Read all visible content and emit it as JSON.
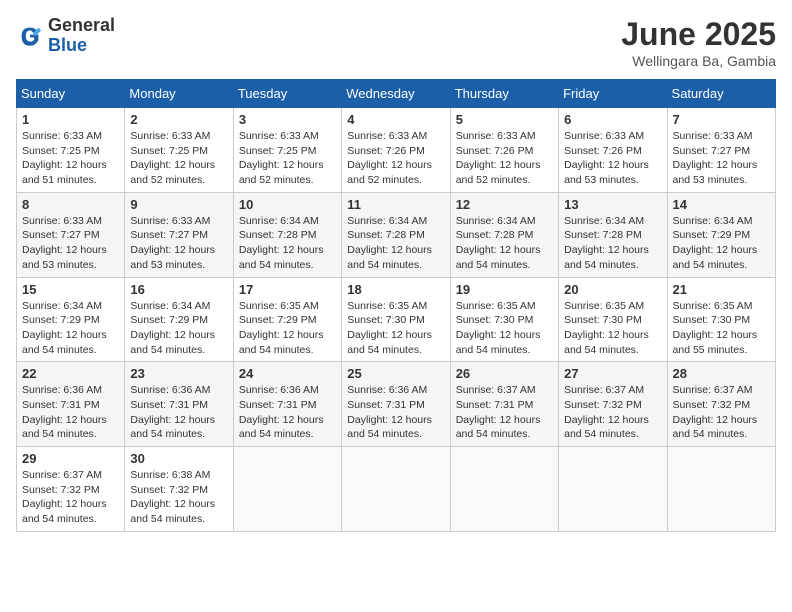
{
  "logo": {
    "general": "General",
    "blue": "Blue"
  },
  "title": {
    "month": "June 2025",
    "location": "Wellingara Ba, Gambia"
  },
  "headers": [
    "Sunday",
    "Monday",
    "Tuesday",
    "Wednesday",
    "Thursday",
    "Friday",
    "Saturday"
  ],
  "weeks": [
    [
      {
        "day": "1",
        "sunrise": "6:33 AM",
        "sunset": "7:25 PM",
        "daylight": "12 hours and 51 minutes."
      },
      {
        "day": "2",
        "sunrise": "6:33 AM",
        "sunset": "7:25 PM",
        "daylight": "12 hours and 52 minutes."
      },
      {
        "day": "3",
        "sunrise": "6:33 AM",
        "sunset": "7:25 PM",
        "daylight": "12 hours and 52 minutes."
      },
      {
        "day": "4",
        "sunrise": "6:33 AM",
        "sunset": "7:26 PM",
        "daylight": "12 hours and 52 minutes."
      },
      {
        "day": "5",
        "sunrise": "6:33 AM",
        "sunset": "7:26 PM",
        "daylight": "12 hours and 52 minutes."
      },
      {
        "day": "6",
        "sunrise": "6:33 AM",
        "sunset": "7:26 PM",
        "daylight": "12 hours and 53 minutes."
      },
      {
        "day": "7",
        "sunrise": "6:33 AM",
        "sunset": "7:27 PM",
        "daylight": "12 hours and 53 minutes."
      }
    ],
    [
      {
        "day": "8",
        "sunrise": "6:33 AM",
        "sunset": "7:27 PM",
        "daylight": "12 hours and 53 minutes."
      },
      {
        "day": "9",
        "sunrise": "6:33 AM",
        "sunset": "7:27 PM",
        "daylight": "12 hours and 53 minutes."
      },
      {
        "day": "10",
        "sunrise": "6:34 AM",
        "sunset": "7:28 PM",
        "daylight": "12 hours and 54 minutes."
      },
      {
        "day": "11",
        "sunrise": "6:34 AM",
        "sunset": "7:28 PM",
        "daylight": "12 hours and 54 minutes."
      },
      {
        "day": "12",
        "sunrise": "6:34 AM",
        "sunset": "7:28 PM",
        "daylight": "12 hours and 54 minutes."
      },
      {
        "day": "13",
        "sunrise": "6:34 AM",
        "sunset": "7:28 PM",
        "daylight": "12 hours and 54 minutes."
      },
      {
        "day": "14",
        "sunrise": "6:34 AM",
        "sunset": "7:29 PM",
        "daylight": "12 hours and 54 minutes."
      }
    ],
    [
      {
        "day": "15",
        "sunrise": "6:34 AM",
        "sunset": "7:29 PM",
        "daylight": "12 hours and 54 minutes."
      },
      {
        "day": "16",
        "sunrise": "6:34 AM",
        "sunset": "7:29 PM",
        "daylight": "12 hours and 54 minutes."
      },
      {
        "day": "17",
        "sunrise": "6:35 AM",
        "sunset": "7:29 PM",
        "daylight": "12 hours and 54 minutes."
      },
      {
        "day": "18",
        "sunrise": "6:35 AM",
        "sunset": "7:30 PM",
        "daylight": "12 hours and 54 minutes."
      },
      {
        "day": "19",
        "sunrise": "6:35 AM",
        "sunset": "7:30 PM",
        "daylight": "12 hours and 54 minutes."
      },
      {
        "day": "20",
        "sunrise": "6:35 AM",
        "sunset": "7:30 PM",
        "daylight": "12 hours and 54 minutes."
      },
      {
        "day": "21",
        "sunrise": "6:35 AM",
        "sunset": "7:30 PM",
        "daylight": "12 hours and 55 minutes."
      }
    ],
    [
      {
        "day": "22",
        "sunrise": "6:36 AM",
        "sunset": "7:31 PM",
        "daylight": "12 hours and 54 minutes."
      },
      {
        "day": "23",
        "sunrise": "6:36 AM",
        "sunset": "7:31 PM",
        "daylight": "12 hours and 54 minutes."
      },
      {
        "day": "24",
        "sunrise": "6:36 AM",
        "sunset": "7:31 PM",
        "daylight": "12 hours and 54 minutes."
      },
      {
        "day": "25",
        "sunrise": "6:36 AM",
        "sunset": "7:31 PM",
        "daylight": "12 hours and 54 minutes."
      },
      {
        "day": "26",
        "sunrise": "6:37 AM",
        "sunset": "7:31 PM",
        "daylight": "12 hours and 54 minutes."
      },
      {
        "day": "27",
        "sunrise": "6:37 AM",
        "sunset": "7:32 PM",
        "daylight": "12 hours and 54 minutes."
      },
      {
        "day": "28",
        "sunrise": "6:37 AM",
        "sunset": "7:32 PM",
        "daylight": "12 hours and 54 minutes."
      }
    ],
    [
      {
        "day": "29",
        "sunrise": "6:37 AM",
        "sunset": "7:32 PM",
        "daylight": "12 hours and 54 minutes."
      },
      {
        "day": "30",
        "sunrise": "6:38 AM",
        "sunset": "7:32 PM",
        "daylight": "12 hours and 54 minutes."
      },
      null,
      null,
      null,
      null,
      null
    ]
  ]
}
